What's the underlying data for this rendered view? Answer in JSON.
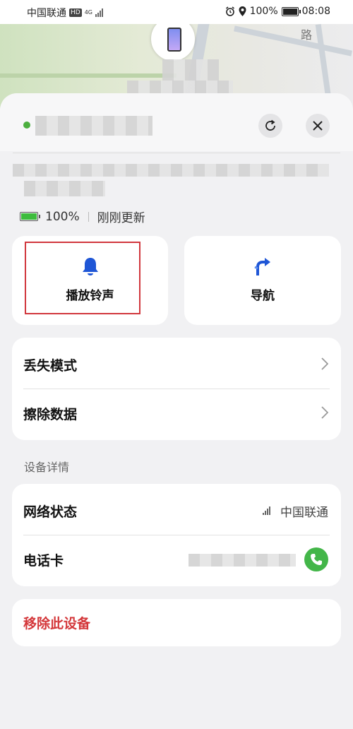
{
  "status_bar": {
    "carrier": "中国联通",
    "hd_badge": "HD",
    "network_badge": "4G",
    "battery_percent": "100%",
    "battery_level": 1.0,
    "time": "08:08"
  },
  "map": {
    "road_label": "路"
  },
  "device_sheet": {
    "battery": "100%",
    "updated": "刚刚更新",
    "actions": [
      {
        "label": "播放铃声",
        "icon": "bell-icon",
        "color": "#1f56d6"
      },
      {
        "label": "导航",
        "icon": "turn-right-arrow-icon",
        "color": "#1f56d6"
      }
    ],
    "options": [
      {
        "label": "丢失模式"
      },
      {
        "label": "擦除数据"
      }
    ],
    "details_title": "设备详情",
    "details": {
      "network_label": "网络状态",
      "network_value": "中国联通",
      "sim_label": "电话卡"
    },
    "remove_label": "移除此设备"
  },
  "colors": {
    "accent": "#1f56d6",
    "danger": "#d4383b",
    "online": "#4caf3f",
    "call": "#43b649"
  }
}
